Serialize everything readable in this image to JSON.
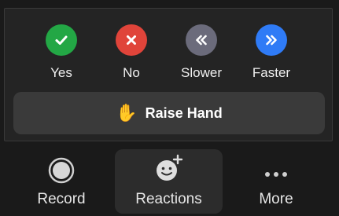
{
  "reactions_panel": {
    "items": [
      {
        "label": "Yes",
        "icon": "checkmark-icon",
        "color": "#23a745"
      },
      {
        "label": "No",
        "icon": "x-icon",
        "color": "#e0443a"
      },
      {
        "label": "Slower",
        "icon": "double-chevron-left-icon",
        "color": "#6b6b7b"
      },
      {
        "label": "Faster",
        "icon": "double-chevron-right-icon",
        "color": "#2f7bf6"
      }
    ],
    "raise_hand": {
      "label": "Raise Hand",
      "icon": "raised-hand-icon"
    }
  },
  "toolbar": {
    "record": {
      "label": "Record",
      "icon": "record-icon"
    },
    "reactions": {
      "label": "Reactions",
      "icon": "add-reaction-smiley-icon",
      "active": true
    },
    "more": {
      "label": "More",
      "icon": "ellipsis-icon"
    }
  }
}
